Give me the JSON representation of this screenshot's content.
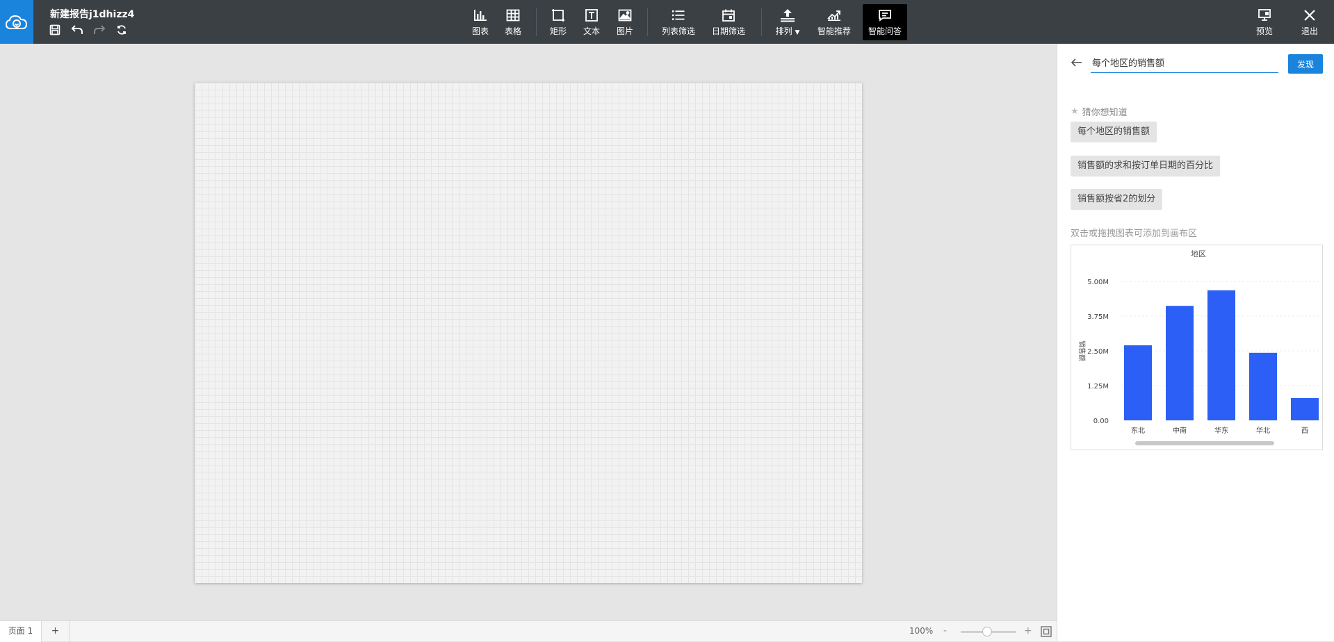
{
  "app": {
    "title": "新建报告j1dhizz4",
    "colors": {
      "topbar": "#3b4044",
      "brand": "#1a84dd",
      "bar": "#2b5ff5"
    },
    "quick_actions": [
      "save-icon",
      "undo-icon",
      "redo-icon",
      "refresh-icon"
    ]
  },
  "toolbar": {
    "chart": "图表",
    "table": "表格",
    "rect": "矩形",
    "text": "文本",
    "image": "图片",
    "list_filter": "列表筛选",
    "date_filter": "日期筛选",
    "arrange": "排列",
    "smart_recommend": "智能推荐",
    "smart_qa": "智能问答",
    "preview": "预览",
    "exit": "退出"
  },
  "panel": {
    "query": "每个地区的销售额",
    "discover": "发现",
    "guess_title": "猜你想知道",
    "suggestions": [
      "每个地区的销售额",
      "销售额的求和按订单日期的百分比",
      "销售额按省2的划分"
    ],
    "hint": "双击或拖拽图表可添加到画布区"
  },
  "chart_data": {
    "type": "bar",
    "title": "地区",
    "ylabel": "销售额",
    "categories": [
      "东北",
      "中南",
      "华东",
      "华北",
      "西"
    ],
    "values": [
      2.7,
      4.12,
      4.68,
      2.43,
      0.8
    ],
    "yticks": [
      "0.00",
      "1.25M",
      "2.50M",
      "3.75M",
      "5.00M"
    ],
    "ylim": [
      0,
      5.0
    ],
    "grid": true
  },
  "footer": {
    "page_tab": "页面 1",
    "add_page": "+",
    "zoom": "100%",
    "zoom_minus": "-",
    "zoom_plus": "+"
  }
}
